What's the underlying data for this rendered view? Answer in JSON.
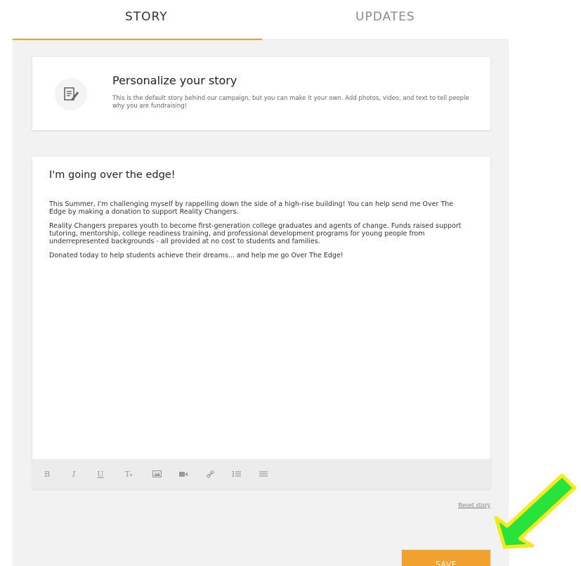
{
  "tabs": {
    "story": "STORY",
    "updates": "UPDATES"
  },
  "card": {
    "icon": "edit-document-icon",
    "title": "Personalize your story",
    "description": "This is the default story behind our campaign, but you can make it your own. Add photos, video, and text to tell people why you are fundraising!"
  },
  "editor": {
    "heading": "I'm going over the edge!",
    "paragraphs": [
      "This Summer, I'm challenging myself by rappelling down the side of a high-rise building! You can help send me Over The Edge by making a donation to support Reality Changers.",
      "Reality Changers prepares youth to become first-generation college graduates and agents of change. Funds raised support tutoring, mentorship, college readiness training, and professional development programs for young people from underrepresented backgrounds - all provided at no cost to students and families.",
      "Donated today to help students achieve their dreams... and help me go Over The Edge!"
    ],
    "toolbar": {
      "bold": "B",
      "italic": "I",
      "underline": "U",
      "text_size": "T",
      "icons": [
        "bold-icon",
        "italic-icon",
        "underline-icon",
        "text-size-icon",
        "image-icon",
        "video-icon",
        "link-icon",
        "ordered-list-icon",
        "unordered-list-icon"
      ]
    }
  },
  "reset_story": "Reset story",
  "save_label": "SAVE",
  "colors": {
    "accent": "#f0a12e",
    "arrow_fill": "#27e33b",
    "arrow_stroke": "#f4ea21"
  }
}
